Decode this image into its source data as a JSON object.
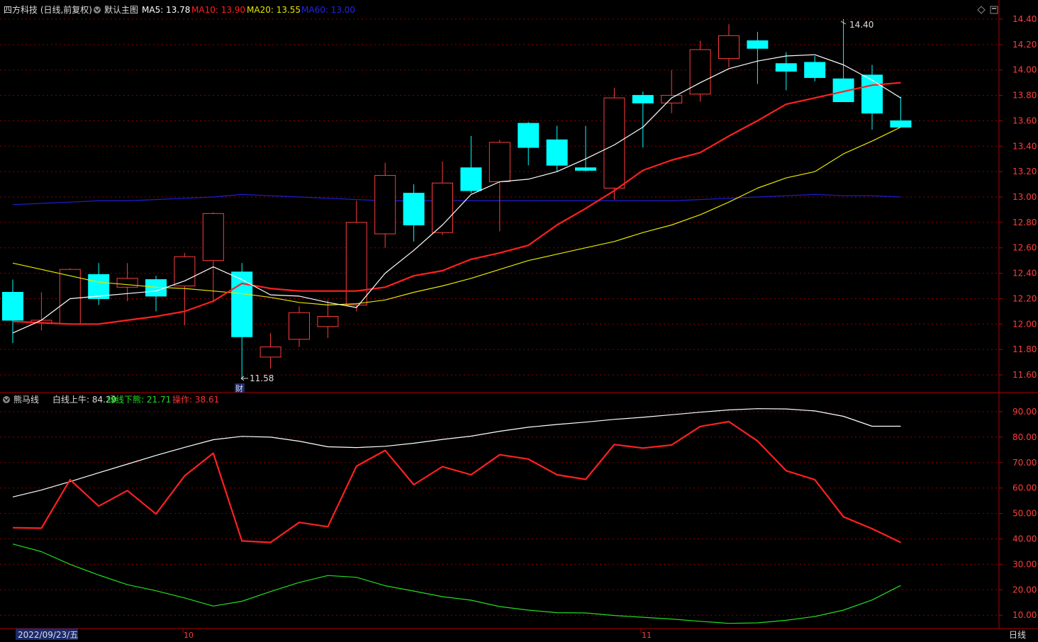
{
  "header": {
    "title": "四方科技 (日线,前复权)",
    "chart_name": "默认主图",
    "ma5": "MA5: 13.78",
    "ma10": "MA10: 13.90",
    "ma20": "MA20: 13.55",
    "ma60": "MA60: 13.00"
  },
  "indicator_header": {
    "name": "熊马线",
    "white": "白线上牛: 84.29",
    "green": "绿线下熊: 21.71",
    "red": "操作: 38.61"
  },
  "annotations": {
    "high": "14.40",
    "low": "11.58",
    "event": "财"
  },
  "x_axis": {
    "cursor_date": "2022/09/23/五",
    "oct": "10",
    "nov": "11",
    "period": "日线"
  },
  "colors": {
    "up": "#ff3c3c",
    "down": "#00ffff",
    "ma5": "#ffffff",
    "ma10": "#ff2020",
    "ma20": "#e6e600",
    "ma60": "#1e1ed8",
    "grid": "#8b0000",
    "axis_text": "#ff3c3c"
  },
  "chart_data": [
    {
      "type": "candlestick",
      "ylim": [
        11.5,
        14.5
      ],
      "y_ticks": [
        "14.40",
        "14.20",
        "14.00",
        "13.80",
        "13.60",
        "13.40",
        "13.20",
        "13.00",
        "12.80",
        "12.60",
        "12.40",
        "12.20",
        "12.00",
        "11.80",
        "11.60"
      ],
      "candles": [
        {
          "o": 12.25,
          "h": 12.35,
          "l": 11.85,
          "c": 12.03
        },
        {
          "o": 12.01,
          "h": 12.25,
          "l": 11.95,
          "c": 12.03
        },
        {
          "o": 12.0,
          "h": 12.44,
          "l": 12.0,
          "c": 12.43
        },
        {
          "o": 12.39,
          "h": 12.48,
          "l": 12.15,
          "c": 12.2
        },
        {
          "o": 12.29,
          "h": 12.48,
          "l": 12.18,
          "c": 12.36
        },
        {
          "o": 12.35,
          "h": 12.38,
          "l": 12.1,
          "c": 12.22
        },
        {
          "o": 12.3,
          "h": 12.56,
          "l": 11.99,
          "c": 12.53
        },
        {
          "o": 12.5,
          "h": 12.88,
          "l": 12.17,
          "c": 12.87
        },
        {
          "o": 12.41,
          "h": 12.48,
          "l": 11.58,
          "c": 11.9
        },
        {
          "o": 11.74,
          "h": 11.93,
          "l": 11.65,
          "c": 11.82
        },
        {
          "o": 11.88,
          "h": 12.14,
          "l": 11.82,
          "c": 12.09
        },
        {
          "o": 11.98,
          "h": 12.19,
          "l": 11.89,
          "c": 12.06
        },
        {
          "o": 12.15,
          "h": 12.97,
          "l": 12.1,
          "c": 12.8
        },
        {
          "o": 12.71,
          "h": 13.27,
          "l": 12.6,
          "c": 13.17
        },
        {
          "o": 13.03,
          "h": 13.1,
          "l": 12.65,
          "c": 12.78
        },
        {
          "o": 12.72,
          "h": 13.28,
          "l": 12.7,
          "c": 13.11
        },
        {
          "o": 13.23,
          "h": 13.48,
          "l": 13.03,
          "c": 13.05
        },
        {
          "o": 13.12,
          "h": 13.45,
          "l": 12.73,
          "c": 13.43
        },
        {
          "o": 13.58,
          "h": 13.59,
          "l": 13.25,
          "c": 13.39
        },
        {
          "o": 13.45,
          "h": 13.56,
          "l": 13.2,
          "c": 13.25
        },
        {
          "o": 13.23,
          "h": 13.56,
          "l": 13.2,
          "c": 13.21
        },
        {
          "o": 13.07,
          "h": 13.86,
          "l": 12.98,
          "c": 13.78
        },
        {
          "o": 13.8,
          "h": 13.83,
          "l": 13.39,
          "c": 13.74
        },
        {
          "o": 13.74,
          "h": 14.0,
          "l": 13.66,
          "c": 13.8
        },
        {
          "o": 13.81,
          "h": 14.23,
          "l": 13.75,
          "c": 14.16
        },
        {
          "o": 14.09,
          "h": 14.36,
          "l": 14.02,
          "c": 14.27
        },
        {
          "o": 14.23,
          "h": 14.3,
          "l": 13.89,
          "c": 14.17
        },
        {
          "o": 14.05,
          "h": 14.14,
          "l": 13.84,
          "c": 13.99
        },
        {
          "o": 14.06,
          "h": 14.11,
          "l": 13.91,
          "c": 13.94
        },
        {
          "o": 13.93,
          "h": 14.4,
          "l": 13.75,
          "c": 13.75
        },
        {
          "o": 13.96,
          "h": 14.04,
          "l": 13.53,
          "c": 13.66
        },
        {
          "o": 13.6,
          "h": 13.79,
          "l": 13.55,
          "c": 13.55
        }
      ],
      "ma5": [
        11.93,
        12.03,
        12.2,
        12.22,
        12.24,
        12.26,
        12.34,
        12.45,
        12.35,
        12.23,
        12.22,
        12.17,
        12.13,
        12.4,
        12.58,
        12.78,
        13.02,
        13.12,
        13.14,
        13.2,
        13.3,
        13.41,
        13.55,
        13.78,
        13.9,
        14.01,
        14.07,
        14.11,
        14.12,
        14.04,
        13.92,
        13.78
      ],
      "ma10": [
        12.02,
        12.01,
        12.0,
        12.0,
        12.03,
        12.06,
        12.1,
        12.18,
        12.32,
        12.28,
        12.26,
        12.26,
        12.26,
        12.29,
        12.38,
        12.42,
        12.51,
        12.56,
        12.62,
        12.78,
        12.91,
        13.05,
        13.21,
        13.29,
        13.35,
        13.48,
        13.6,
        13.73,
        13.78,
        13.83,
        13.88,
        13.9
      ],
      "ma20": [
        12.48,
        12.43,
        12.38,
        12.33,
        12.31,
        12.29,
        12.28,
        12.26,
        12.24,
        12.21,
        12.17,
        12.15,
        12.16,
        12.19,
        12.25,
        12.3,
        12.36,
        12.43,
        12.5,
        12.55,
        12.6,
        12.65,
        12.72,
        12.78,
        12.86,
        12.96,
        13.07,
        13.15,
        13.2,
        13.34,
        13.44,
        13.55
      ],
      "ma60": [
        12.94,
        12.95,
        12.96,
        12.97,
        12.97,
        12.98,
        12.99,
        13.0,
        13.02,
        13.01,
        13.0,
        12.99,
        12.98,
        12.97,
        12.97,
        12.97,
        12.97,
        12.97,
        12.97,
        12.97,
        12.97,
        12.97,
        12.97,
        12.97,
        12.98,
        12.99,
        13.0,
        13.01,
        13.02,
        13.01,
        13.01,
        13.0
      ]
    },
    {
      "type": "line",
      "ylim": [
        5,
        95
      ],
      "y_ticks": [
        "90.00",
        "80.00",
        "70.00",
        "60.00",
        "50.00",
        "40.00",
        "30.00",
        "20.00",
        "10.00"
      ],
      "series": [
        {
          "name": "白线上牛",
          "values": [
            56.5,
            59.2,
            62.5,
            66.0,
            69.4,
            72.8,
            76.0,
            79.0,
            80.3,
            80.0,
            78.4,
            76.2,
            75.9,
            76.4,
            77.6,
            79.1,
            80.4,
            82.3,
            83.9,
            85.0,
            85.9,
            87.0,
            87.8,
            88.8,
            89.8,
            90.7,
            91.2,
            91.1,
            90.3,
            88.2,
            84.29,
            84.29
          ]
        },
        {
          "name": "绿线下熊",
          "values": [
            38.0,
            35.0,
            30.0,
            25.8,
            22.0,
            19.6,
            16.8,
            13.6,
            15.5,
            19.3,
            22.9,
            25.6,
            24.9,
            21.6,
            19.5,
            17.3,
            15.9,
            13.4,
            12.0,
            11.0,
            10.9,
            9.9,
            9.2,
            8.5,
            7.6,
            6.8,
            7.0,
            8.0,
            9.5,
            12.0,
            16.0,
            21.71
          ]
        },
        {
          "name": "操作",
          "values": [
            44.4,
            44.2,
            63.3,
            52.9,
            59.0,
            49.8,
            64.8,
            73.7,
            39.2,
            38.6,
            46.5,
            44.8,
            68.6,
            74.8,
            61.3,
            68.4,
            65.2,
            73.1,
            71.4,
            65.2,
            63.4,
            77.1,
            75.7,
            76.9,
            84.2,
            86.1,
            78.5,
            66.8,
            63.3,
            48.7,
            44.0,
            38.61
          ]
        }
      ]
    }
  ]
}
